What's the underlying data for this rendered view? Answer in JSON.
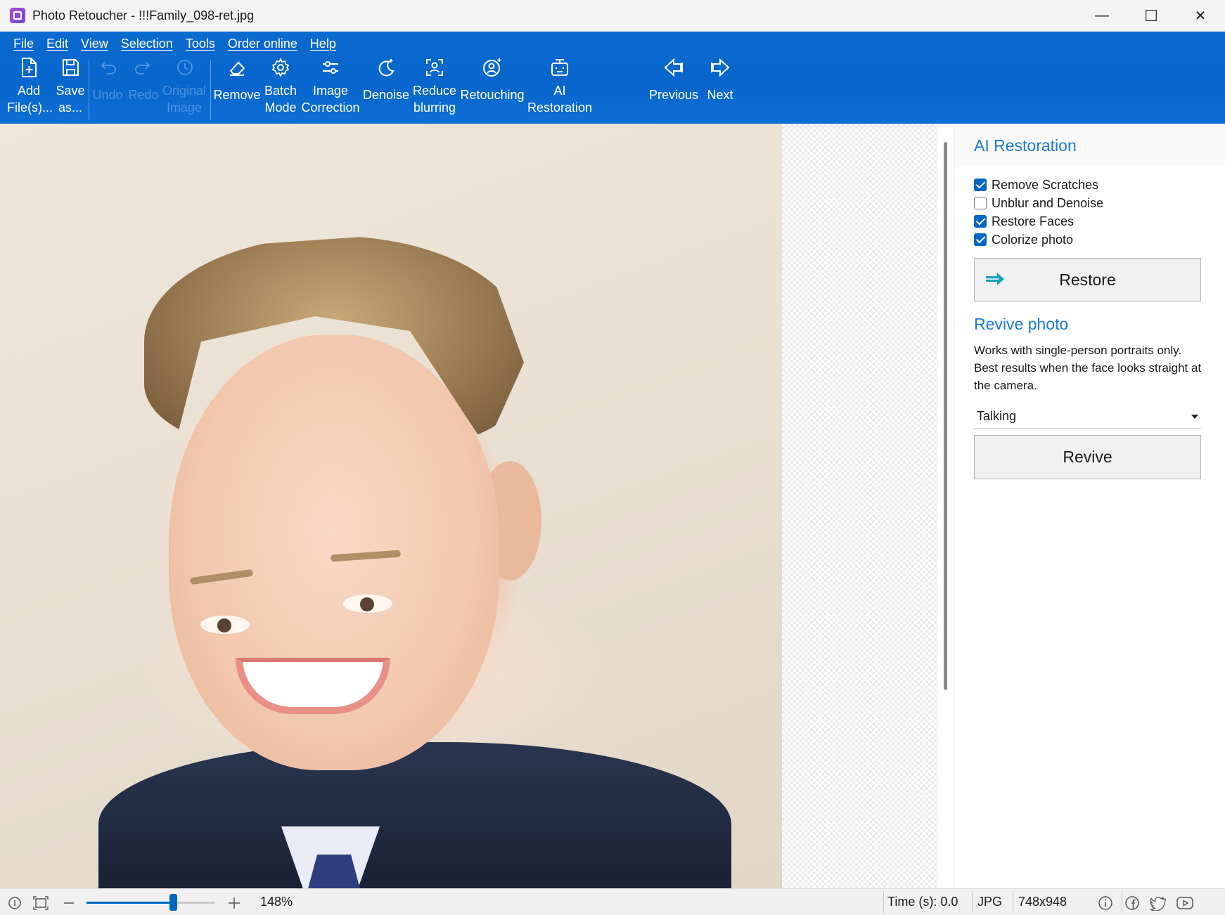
{
  "window": {
    "title": "Photo Retoucher - !!!Family_098-ret.jpg",
    "minimize_glyph": "—",
    "maximize_glyph": "☐",
    "close_glyph": "✕"
  },
  "menu": [
    "File",
    "Edit",
    "View",
    "Selection",
    "Tools",
    "Order online",
    "Help"
  ],
  "toolbar": {
    "add_files": [
      "Add",
      "File(s)..."
    ],
    "save_as": [
      "Save",
      "as..."
    ],
    "undo": "Undo",
    "redo": "Redo",
    "original_image": [
      "Original",
      "Image"
    ],
    "remove": "Remove",
    "batch_mode": [
      "Batch",
      "Mode"
    ],
    "image_correction": [
      "Image",
      "Correction"
    ],
    "denoise": "Denoise",
    "reduce_blurring": [
      "Reduce",
      "blurring"
    ],
    "retouching": "Retouching",
    "ai_restoration": [
      "AI",
      "Restoration"
    ],
    "previous": "Previous",
    "next": "Next"
  },
  "panel": {
    "title": "AI Restoration",
    "options": [
      {
        "label": "Remove Scratches",
        "checked": true
      },
      {
        "label": "Unblur and Denoise",
        "checked": false
      },
      {
        "label": "Restore Faces",
        "checked": true
      },
      {
        "label": "Colorize photo",
        "checked": true
      }
    ],
    "restore_label": "Restore",
    "revive_title": "Revive photo",
    "revive_desc": "Works with single-person portraits only. Best results when the face looks straight at the camera.",
    "revive_mode": "Talking",
    "revive_label": "Revive"
  },
  "status": {
    "zoom": "148%",
    "zoom_fraction": 0.68,
    "time": "Time (s): 0.0",
    "format": "JPG",
    "dimensions": "748x948"
  },
  "colors": {
    "accent": "#0067c0",
    "ribbon": "#0866cc",
    "panel_title": "#1a7ad8"
  },
  "icons": {
    "add_files": "add-file-icon",
    "save_as": "save-icon",
    "undo": "undo-icon",
    "redo": "redo-icon",
    "original": "history-icon",
    "remove": "eraser-icon",
    "batch": "gear-icon",
    "correction": "sliders-icon",
    "denoise": "moon-sparkle-icon",
    "blur": "focus-person-icon",
    "retouch": "face-sparkle-icon",
    "ai": "robot-icon",
    "previous": "arrow-left-icon",
    "next": "arrow-right-icon"
  }
}
